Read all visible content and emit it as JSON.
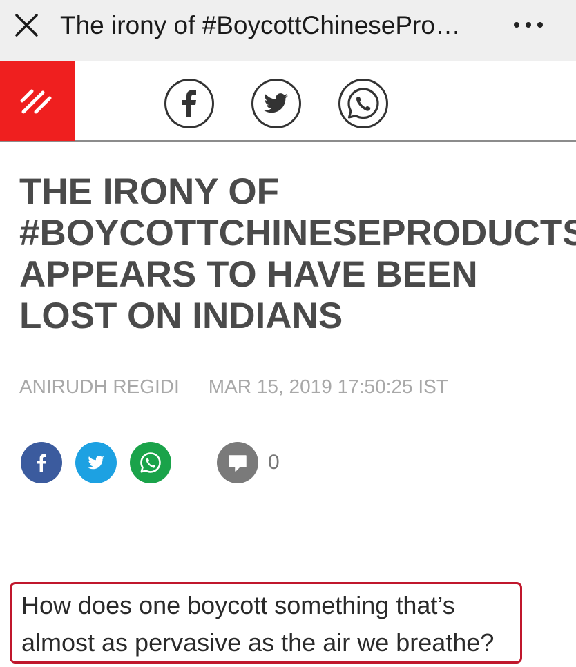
{
  "appbar": {
    "title": "The irony of #BoycottChinesePro…",
    "close_icon": "close-icon",
    "more_icon": "more-options-icon"
  },
  "site_header": {
    "logo_color": "#ef1f1f",
    "share_icons": [
      "facebook-icon",
      "twitter-icon",
      "whatsapp-icon"
    ]
  },
  "article": {
    "headline_lines": [
      "THE IRONY OF",
      "#BOYCOTTCHINESEPRODUCTS",
      "APPEARS TO HAVE BEEN",
      "LOST ON INDIANS"
    ],
    "author": "ANIRUDH REGIDI",
    "date": "MAR 15, 2019 17:50:25 IST",
    "comment_count": "0",
    "pullquote": "How does one boycott something that’s almost as pervasive as the air we breathe?"
  },
  "colors": {
    "facebook": "#3b5b9e",
    "twitter": "#1da1e2",
    "whatsapp": "#1aa34a",
    "comment": "#7a7a7a",
    "highlight_border": "#c0172c"
  }
}
